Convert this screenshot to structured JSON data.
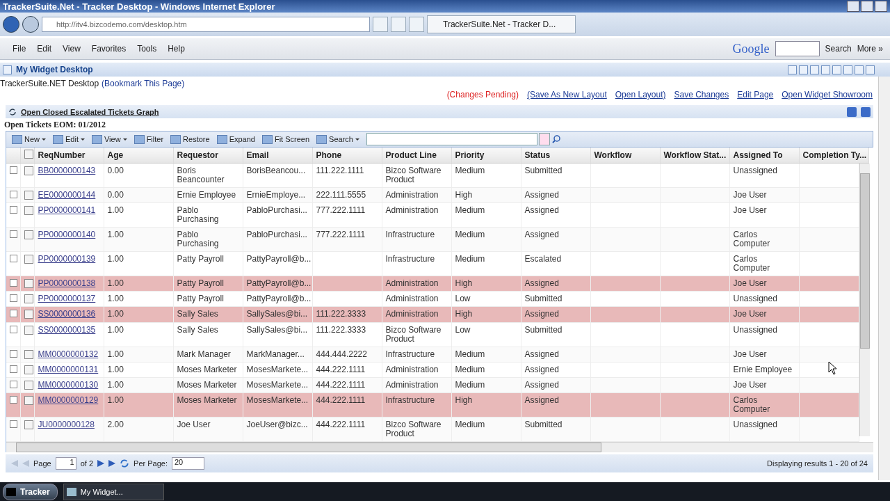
{
  "window": {
    "title": "TrackerSuite.Net - Tracker Desktop - Windows Internet Explorer"
  },
  "browser": {
    "url": "http://itv4.bizcodemo.com/desktop.htm",
    "tab": "TrackerSuite.Net - Tracker D...",
    "menu": [
      "File",
      "Edit",
      "View",
      "Favorites",
      "Tools",
      "Help"
    ],
    "google": {
      "logo": "Google",
      "search": "Search",
      "more": "More »"
    }
  },
  "widget_bar": {
    "title": "My Widget Desktop"
  },
  "desktop": {
    "title": "TrackerSuite.NET Desktop",
    "bookmark": "(Bookmark This Page)",
    "pending": "(Changes Pending)",
    "links": [
      "(Save As New Layout",
      "Open Layout)",
      "Save Changes",
      "Edit Page",
      "Open Widget Showroom"
    ]
  },
  "panel": {
    "title": "Open Closed Escalated Tickets Graph",
    "subtitle": "Open Tickets EOM: 01/2012"
  },
  "toolbar": [
    {
      "label": "New",
      "dropdown": true
    },
    {
      "label": "Edit",
      "dropdown": true
    },
    {
      "label": "View",
      "dropdown": true
    },
    {
      "label": "Filter",
      "dropdown": false
    },
    {
      "label": "Restore",
      "dropdown": false
    },
    {
      "label": "Expand",
      "dropdown": false
    },
    {
      "label": "Fit Screen",
      "dropdown": false
    },
    {
      "label": "Search",
      "dropdown": true
    }
  ],
  "table": {
    "select_all_checked": false,
    "columns": [
      "ReqNumber",
      "Age",
      "Requestor",
      "Email",
      "Phone",
      "Product Line",
      "Priority",
      "Status",
      "Workflow",
      "Workflow Stat...",
      "Assigned To",
      "Completion Ty..."
    ],
    "rows": [
      {
        "id": "BB0000000143",
        "age": "0.00",
        "requestor": "Boris Beancounter",
        "email": "BorisBeancou...",
        "phone": "111.222.1111",
        "product_line": "Bizco Software Product",
        "priority": "Medium",
        "status": "Submitted",
        "assigned_to": "Unassigned",
        "highlighted": false,
        "checked": false
      },
      {
        "id": "EE0000000144",
        "age": "0.00",
        "requestor": "Ernie Employee",
        "email": "ErnieEmploye...",
        "phone": "222.111.5555",
        "product_line": "Administration",
        "priority": "High",
        "status": "Assigned",
        "assigned_to": "Joe User",
        "highlighted": false,
        "checked": false
      },
      {
        "id": "PP0000000141",
        "age": "1.00",
        "requestor": "Pablo Purchasing",
        "email": "PabloPurchasi...",
        "phone": "777.222.1111",
        "product_line": "Administration",
        "priority": "Medium",
        "status": "Assigned",
        "assigned_to": "Joe User",
        "highlighted": false,
        "checked": false
      },
      {
        "id": "PP0000000140",
        "age": "1.00",
        "requestor": "Pablo Purchasing",
        "email": "PabloPurchasi...",
        "phone": "777.222.1111",
        "product_line": "Infrastructure",
        "priority": "Medium",
        "status": "Assigned",
        "assigned_to": "Carlos Computer",
        "highlighted": false,
        "checked": false
      },
      {
        "id": "PP0000000139",
        "age": "1.00",
        "requestor": "Patty Payroll",
        "email": "PattyPayroll@b...",
        "product_line": "Infrastructure",
        "priority": "Medium",
        "status": "Escalated",
        "assigned_to": "Carlos Computer",
        "highlighted": false,
        "checked": false
      },
      {
        "id": "PP0000000138",
        "age": "1.00",
        "requestor": "Patty Payroll",
        "email": "PattyPayroll@b...",
        "product_line": "Administration",
        "priority": "High",
        "status": "Assigned",
        "assigned_to": "Joe User",
        "highlighted": true,
        "checked": false
      },
      {
        "id": "PP0000000137",
        "age": "1.00",
        "requestor": "Patty Payroll",
        "email": "PattyPayroll@b...",
        "product_line": "Administration",
        "priority": "Low",
        "status": "Submitted",
        "assigned_to": "Unassigned",
        "highlighted": false,
        "checked": false
      },
      {
        "id": "SS0000000136",
        "age": "1.00",
        "requestor": "Sally Sales",
        "email": "SallySales@bi...",
        "phone": "111.222.3333",
        "product_line": "Administration",
        "priority": "High",
        "status": "Assigned",
        "assigned_to": "Joe User",
        "highlighted": true,
        "checked": false
      },
      {
        "id": "SS0000000135",
        "age": "1.00",
        "requestor": "Sally Sales",
        "email": "SallySales@bi...",
        "phone": "111.222.3333",
        "product_line": "Bizco Software Product",
        "priority": "Low",
        "status": "Submitted",
        "assigned_to": "Unassigned",
        "highlighted": false,
        "checked": false
      },
      {
        "id": "MM0000000132",
        "age": "1.00",
        "requestor": "Mark Manager",
        "email": "MarkManager...",
        "phone": "444.444.2222",
        "product_line": "Infrastructure",
        "priority": "Medium",
        "status": "Assigned",
        "assigned_to": "Joe User",
        "highlighted": false,
        "checked": false
      },
      {
        "id": "MM0000000131",
        "age": "1.00",
        "requestor": "Moses Marketer",
        "email": "MosesMarkete...",
        "phone": "444.222.1111",
        "product_line": "Administration",
        "priority": "Medium",
        "status": "Assigned",
        "assigned_to": "Ernie Employee",
        "highlighted": false,
        "checked": false
      },
      {
        "id": "MM0000000130",
        "age": "1.00",
        "requestor": "Moses Marketer",
        "email": "MosesMarkete...",
        "phone": "444.222.1111",
        "product_line": "Administration",
        "priority": "Medium",
        "status": "Assigned",
        "assigned_to": "Joe User",
        "highlighted": false,
        "checked": false
      },
      {
        "id": "MM0000000129",
        "age": "1.00",
        "requestor": "Moses Marketer",
        "email": "MosesMarkete...",
        "phone": "444.222.1111",
        "product_line": "Infrastructure",
        "priority": "High",
        "status": "Assigned",
        "assigned_to": "Carlos Computer",
        "highlighted": true,
        "checked": false
      },
      {
        "id": "JU0000000128",
        "age": "2.00",
        "requestor": "Joe User",
        "email": "JoeUser@bizc...",
        "phone": "444.222.1111",
        "product_line": "Bizco Software Product",
        "priority": "Medium",
        "status": "Submitted",
        "assigned_to": "Unassigned",
        "highlighted": false,
        "checked": false
      }
    ]
  },
  "pager": {
    "page_label": "Page",
    "page": "1",
    "of": "of 2",
    "per_page_label": "Per Page:",
    "per_page": "20",
    "summary": "Displaying results 1 - 20 of 24"
  },
  "taskbar": {
    "start": "Tracker",
    "items": [
      "My Widget..."
    ]
  }
}
